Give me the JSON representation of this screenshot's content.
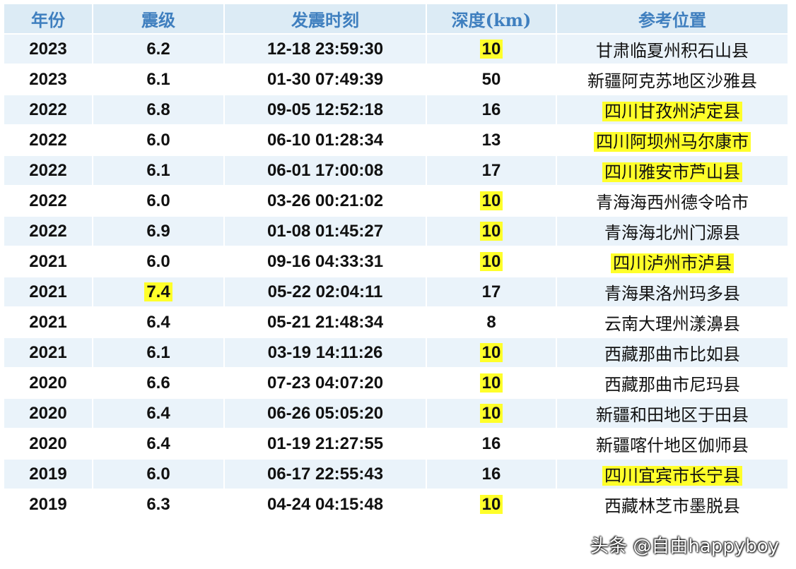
{
  "table": {
    "headers": [
      "年份",
      "震级",
      "发震时刻",
      "深度(km)",
      "参考位置"
    ],
    "rows": [
      {
        "year": "2023",
        "mag": "6.2",
        "time": "12-18 23:59:30",
        "depth": "10",
        "loc": "甘肃临夏州积石山县",
        "mag_hl": false,
        "depth_hl": true,
        "loc_hl": false
      },
      {
        "year": "2023",
        "mag": "6.1",
        "time": "01-30 07:49:39",
        "depth": "50",
        "loc": "新疆阿克苏地区沙雅县",
        "mag_hl": false,
        "depth_hl": false,
        "loc_hl": false
      },
      {
        "year": "2022",
        "mag": "6.8",
        "time": "09-05 12:52:18",
        "depth": "16",
        "loc": "四川甘孜州泸定县",
        "mag_hl": false,
        "depth_hl": false,
        "loc_hl": true
      },
      {
        "year": "2022",
        "mag": "6.0",
        "time": "06-10 01:28:34",
        "depth": "13",
        "loc": "四川阿坝州马尔康市",
        "mag_hl": false,
        "depth_hl": false,
        "loc_hl": true
      },
      {
        "year": "2022",
        "mag": "6.1",
        "time": "06-01 17:00:08",
        "depth": "17",
        "loc": "四川雅安市芦山县",
        "mag_hl": false,
        "depth_hl": false,
        "loc_hl": true
      },
      {
        "year": "2022",
        "mag": "6.0",
        "time": "03-26 00:21:02",
        "depth": "10",
        "loc": "青海海西州德令哈市",
        "mag_hl": false,
        "depth_hl": true,
        "loc_hl": false
      },
      {
        "year": "2022",
        "mag": "6.9",
        "time": "01-08 01:45:27",
        "depth": "10",
        "loc": "青海海北州门源县",
        "mag_hl": false,
        "depth_hl": true,
        "loc_hl": false
      },
      {
        "year": "2021",
        "mag": "6.0",
        "time": "09-16 04:33:31",
        "depth": "10",
        "loc": "四川泸州市泸县",
        "mag_hl": false,
        "depth_hl": true,
        "loc_hl": true
      },
      {
        "year": "2021",
        "mag": "7.4",
        "time": "05-22 02:04:11",
        "depth": "17",
        "loc": "青海果洛州玛多县",
        "mag_hl": true,
        "depth_hl": false,
        "loc_hl": false
      },
      {
        "year": "2021",
        "mag": "6.4",
        "time": "05-21 21:48:34",
        "depth": "8",
        "loc": "云南大理州漾濞县",
        "mag_hl": false,
        "depth_hl": false,
        "loc_hl": false
      },
      {
        "year": "2021",
        "mag": "6.1",
        "time": "03-19 14:11:26",
        "depth": "10",
        "loc": "西藏那曲市比如县",
        "mag_hl": false,
        "depth_hl": true,
        "loc_hl": false
      },
      {
        "year": "2020",
        "mag": "6.6",
        "time": "07-23 04:07:20",
        "depth": "10",
        "loc": "西藏那曲市尼玛县",
        "mag_hl": false,
        "depth_hl": true,
        "loc_hl": false
      },
      {
        "year": "2020",
        "mag": "6.4",
        "time": "06-26 05:05:20",
        "depth": "10",
        "loc": "新疆和田地区于田县",
        "mag_hl": false,
        "depth_hl": true,
        "loc_hl": false
      },
      {
        "year": "2020",
        "mag": "6.4",
        "time": "01-19 21:27:55",
        "depth": "16",
        "loc": "新疆喀什地区伽师县",
        "mag_hl": false,
        "depth_hl": false,
        "loc_hl": false
      },
      {
        "year": "2019",
        "mag": "6.0",
        "time": "06-17 22:55:43",
        "depth": "16",
        "loc": "四川宜宾市长宁县",
        "mag_hl": false,
        "depth_hl": false,
        "loc_hl": true
      },
      {
        "year": "2019",
        "mag": "6.3",
        "time": "04-24 04:15:48",
        "depth": "10",
        "loc": "西藏林芝市墨脱县",
        "mag_hl": false,
        "depth_hl": true,
        "loc_hl": false
      }
    ]
  },
  "colors": {
    "header_bg": "#dcebf5",
    "header_text": "#3f7fbf",
    "row_alt_bg": "#eaf3fa",
    "highlight": "#ffff2a"
  },
  "watermark": "头条 @自由happyboy"
}
